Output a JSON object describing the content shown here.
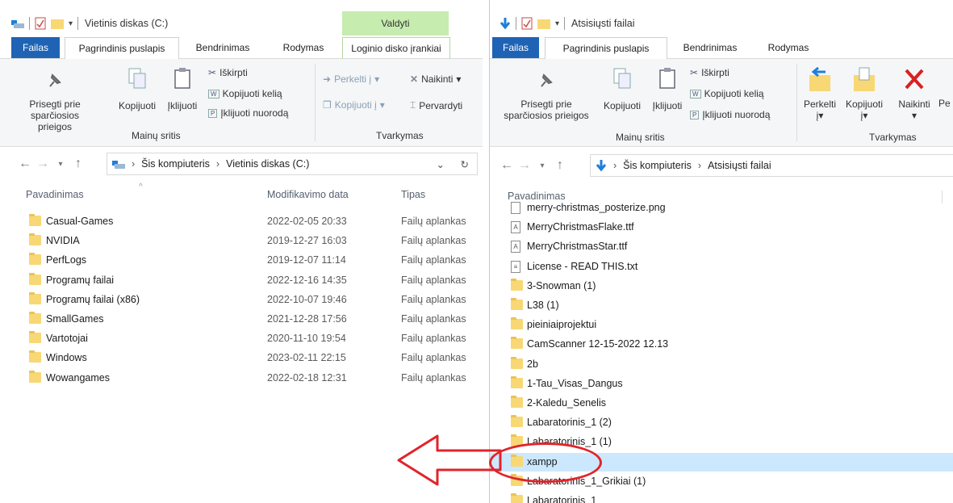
{
  "left": {
    "title": "Vietinis diskas (C:)",
    "manage_tab": "Valdyti",
    "tabs": [
      "Failas",
      "Pagrindinis puslapis",
      "Bendrinimas",
      "Rodymas",
      "Loginio disko įrankiai"
    ],
    "ribbon": {
      "pin": [
        "Prisegti prie",
        "sparčiosios prieigos"
      ],
      "copy": "Kopijuoti",
      "paste": "Įklijuoti",
      "cut": "Iškirpti",
      "copy_path": "Kopijuoti kelią",
      "paste_shortcut": "Įklijuoti nuorodą",
      "move_to": "Perkelti į",
      "copy_to": "Kopijuoti į",
      "delete": "Naikinti",
      "rename": "Pervardyti",
      "group_clipboard": "Mainų sritis",
      "group_organize": "Tvarkymas"
    },
    "address": [
      "Šis kompiuteris",
      "Vietinis diskas (C:)"
    ],
    "columns": {
      "name": "Pavadinimas",
      "date": "Modifikavimo data",
      "type": "Tipas"
    },
    "rows": [
      {
        "name": "Casual-Games",
        "date": "2022-02-05 20:33",
        "type": "Failų aplankas"
      },
      {
        "name": "NVIDIA",
        "date": "2019-12-27 16:03",
        "type": "Failų aplankas"
      },
      {
        "name": "PerfLogs",
        "date": "2019-12-07 11:14",
        "type": "Failų aplankas"
      },
      {
        "name": "Programų failai",
        "date": "2022-12-16 14:35",
        "type": "Failų aplankas"
      },
      {
        "name": "Programų failai (x86)",
        "date": "2022-10-07 19:46",
        "type": "Failų aplankas"
      },
      {
        "name": "SmallGames",
        "date": "2021-12-28 17:56",
        "type": "Failų aplankas"
      },
      {
        "name": "Vartotojai",
        "date": "2020-11-10 19:54",
        "type": "Failų aplankas"
      },
      {
        "name": "Windows",
        "date": "2023-02-11 22:15",
        "type": "Failų aplankas"
      },
      {
        "name": "Wowangames",
        "date": "2022-02-18 12:31",
        "type": "Failų aplankas"
      }
    ]
  },
  "right": {
    "title": "Atsisiųsti failai",
    "tabs": [
      "Failas",
      "Pagrindinis puslapis",
      "Bendrinimas",
      "Rodymas"
    ],
    "ribbon": {
      "pin": [
        "Prisegti prie",
        "sparčiosios prieigos"
      ],
      "copy": "Kopijuoti",
      "paste": "Įklijuoti",
      "cut": "Iškirpti",
      "copy_path": "Kopijuoti kelią",
      "paste_shortcut": "Įklijuoti nuorodą",
      "move": "Perkelti",
      "move_sub": "į",
      "copy2": "Kopijuoti",
      "copy2_sub": "į",
      "delete": "Naikinti",
      "rename_partial": "Pe",
      "group_clipboard": "Mainų sritis",
      "group_organize": "Tvarkymas"
    },
    "address": [
      "Šis kompiuteris",
      "Atsisiųsti failai"
    ],
    "columns": {
      "name": "Pavadinimas"
    },
    "rows": [
      {
        "name": "merry-christmas_posterize.png",
        "kind": "file"
      },
      {
        "name": "MerryChristmasFlake.ttf",
        "kind": "font"
      },
      {
        "name": "MerryChristmasStar.ttf",
        "kind": "font"
      },
      {
        "name": "License - READ THIS.txt",
        "kind": "text"
      },
      {
        "name": "3-Snowman (1)",
        "kind": "folder"
      },
      {
        "name": "L38 (1)",
        "kind": "folder"
      },
      {
        "name": "pieiniaiprojektui",
        "kind": "folder"
      },
      {
        "name": "CamScanner 12-15-2022 12.13",
        "kind": "folder"
      },
      {
        "name": "2b",
        "kind": "folder"
      },
      {
        "name": "1-Tau_Visas_Dangus",
        "kind": "folder"
      },
      {
        "name": "2-Kaledu_Senelis",
        "kind": "folder"
      },
      {
        "name": "Labaratorinis_1 (2)",
        "kind": "folder"
      },
      {
        "name": "Labaratorinis_1 (1)",
        "kind": "folder"
      },
      {
        "name": "xampp",
        "kind": "folder",
        "selected": true
      },
      {
        "name": "Labaratorinis_1_Grikiai (1)",
        "kind": "folder"
      },
      {
        "name": "Labaratorinis_1",
        "kind": "folder"
      }
    ]
  },
  "annotation_color": "#e0242a"
}
